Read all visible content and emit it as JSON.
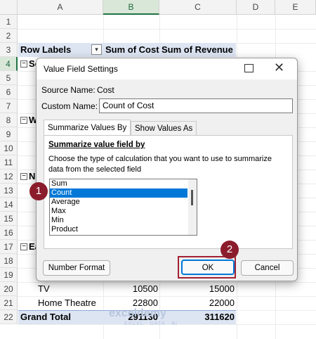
{
  "columns": [
    "A",
    "B",
    "C",
    "D",
    "E"
  ],
  "rows": [
    "1",
    "2",
    "3",
    "4",
    "5",
    "6",
    "7",
    "8",
    "9",
    "10",
    "11",
    "12",
    "13",
    "14",
    "15",
    "16",
    "17",
    "18",
    "19",
    "20",
    "21",
    "22"
  ],
  "sheet": {
    "header_row_labels": "Row Labels",
    "header_sum_cost": "Sum of Cost",
    "header_sum_revenue": "Sum of Revenue",
    "group_s": "So",
    "group_w": "W",
    "group_n": "N",
    "group_e": "Ea",
    "tv_label": "TV",
    "tv_cost": "10500",
    "tv_revenue": "15000",
    "ht_label": "Home Theatre",
    "ht_cost": "22800",
    "ht_revenue": "22000",
    "grand_total_label": "Grand Total",
    "grand_total_cost": "291130",
    "grand_total_revenue": "311620",
    "minus_glyph": "−",
    "filter_glyph": "▾"
  },
  "dialog": {
    "title": "Value Field Settings",
    "source_name_label": "Source Name:",
    "source_name_value": "Cost",
    "custom_name_label": "Custom Name:",
    "custom_name_value": "Count of Cost",
    "tabs": [
      "Summarize Values By",
      "Show Values As"
    ],
    "section_title": "Summarize value field by",
    "description_line1": "Choose the type of calculation that you want to use to summarize",
    "description_line2": "data from the selected field",
    "list_items": [
      "Sum",
      "Count",
      "Average",
      "Max",
      "Min",
      "Product"
    ],
    "selected_item": "Count",
    "number_format_button": "Number Format",
    "ok_button": "OK",
    "cancel_button": "Cancel",
    "close_glyph": "✕"
  },
  "annotations": {
    "badge_1": "1",
    "badge_2": "2"
  },
  "watermark": {
    "logo": "exceldemy",
    "tagline": "EXCEL · DATA · BI"
  },
  "colors": {
    "accent_green": "#217346",
    "selection_blue": "#0078d7",
    "badge_red": "#8b1c2c",
    "pivot_header_blue": "#dde5f3"
  }
}
